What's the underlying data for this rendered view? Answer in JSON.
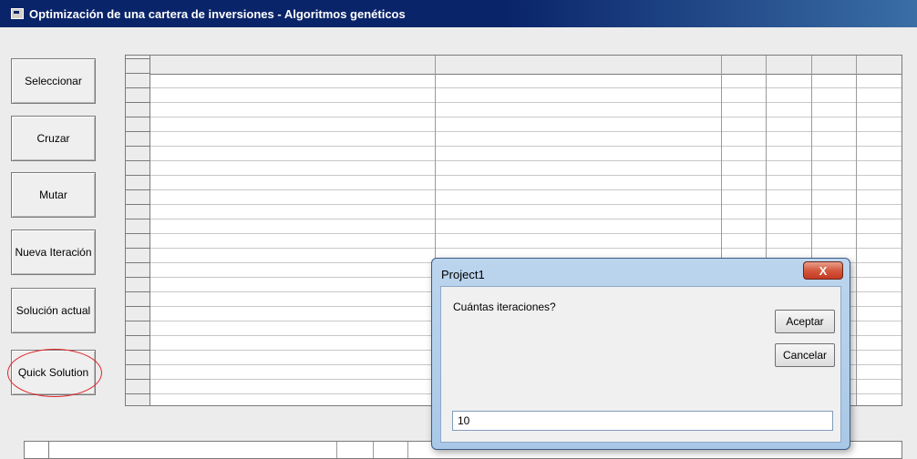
{
  "window": {
    "title": "Optimización de una cartera de inversiones - Algoritmos genéticos",
    "icon": "app-window-icon"
  },
  "buttons": {
    "select": "Seleccionar",
    "cross": "Cruzar",
    "mutate": "Mutar",
    "new_iteration": "Nueva Iteración",
    "current_solution": "Solución actual",
    "quick_solution": "Quick Solution"
  },
  "annotation": {
    "color": "#e0242a",
    "target": "quick-solution-button"
  },
  "dialog": {
    "title": "Project1",
    "close_label": "X",
    "prompt": "Cuántas iteraciones?",
    "ok_label": "Aceptar",
    "cancel_label": "Cancelar",
    "input_value": "10"
  }
}
